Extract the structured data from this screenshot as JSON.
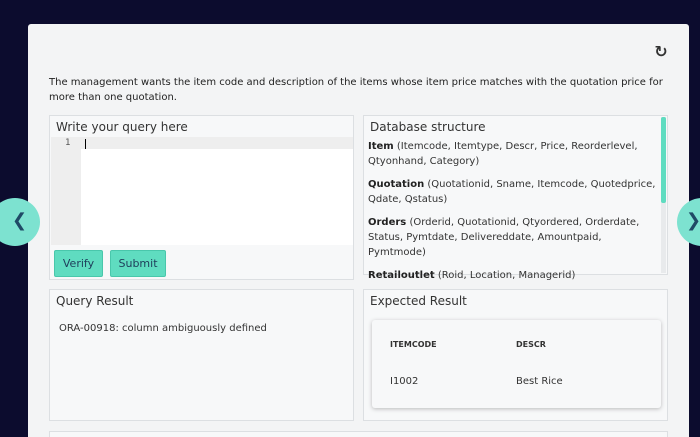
{
  "question": "The management wants the item code and description of the items whose item price matches with the quotation price for more than one quotation.",
  "icons": {
    "refresh": "refresh-icon",
    "prev": "chevron-left-icon",
    "next": "chevron-right-icon"
  },
  "accent_color": "#5fdcc0",
  "query_panel": {
    "title": "Write your query here",
    "line_number": "1",
    "verify_label": "Verify",
    "submit_label": "Submit"
  },
  "db_panel": {
    "title": "Database structure",
    "tables": [
      {
        "name": "Item",
        "columns": "(Itemcode, Itemtype, Descr, Price, Reorderlevel, Qtyonhand, Category)"
      },
      {
        "name": "Quotation",
        "columns": "(Quotationid, Sname, Itemcode, Quotedprice, Qdate, Qstatus)"
      },
      {
        "name": "Orders",
        "columns": "(Orderid, Quotationid, Qtyordered, Orderdate, Status, Pymtdate, Delivereddate, Amountpaid, Pymtmode)"
      },
      {
        "name": "Retailoutlet",
        "columns": "(Roid, Location, Managerid)"
      }
    ]
  },
  "result_panel": {
    "title": "Query Result",
    "message": "ORA-00918: column ambiguously defined"
  },
  "expected_panel": {
    "title": "Expected Result",
    "headers": [
      "ITEMCODE",
      "DESCR"
    ],
    "rows": [
      [
        "I1002",
        "Best Rice"
      ]
    ]
  }
}
